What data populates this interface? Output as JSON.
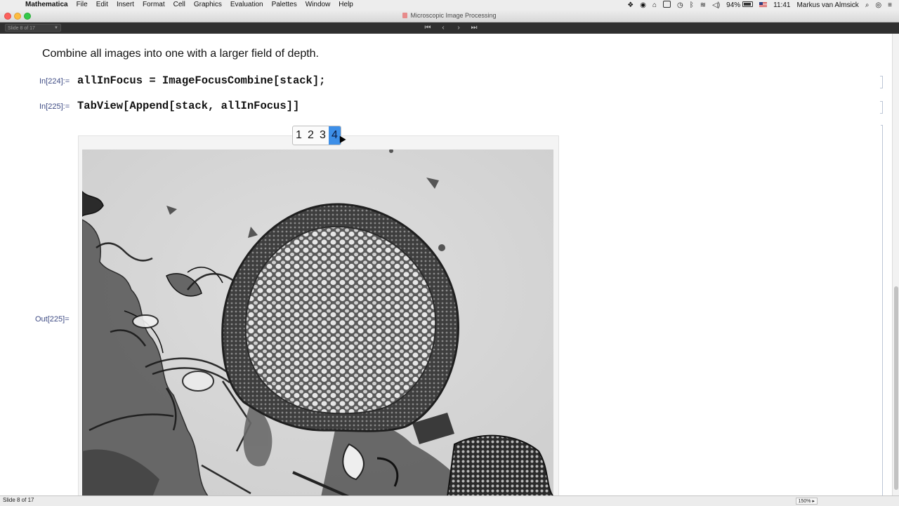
{
  "menubar": {
    "app": "Mathematica",
    "menus": [
      "File",
      "Edit",
      "Insert",
      "Format",
      "Cell",
      "Graphics",
      "Evaluation",
      "Palettes",
      "Window",
      "Help"
    ],
    "battery": "94%",
    "time": "11:41",
    "user": "Markus van Almsick"
  },
  "window": {
    "title": "Microscopic Image Processing"
  },
  "slidebar": {
    "selector_text": "Slide 8 of 17"
  },
  "notebook": {
    "text_cell": "Combine all images into one with a larger field of depth.",
    "cells": [
      {
        "label": "In[224]:=",
        "code": "allInFocus = ImageFocusCombine[stack];"
      },
      {
        "label": "In[225]:=",
        "code": "TabView[Append[stack, allInFocus]]"
      }
    ],
    "out_label": "Out[225]=",
    "tabs": [
      "1",
      "2",
      "3",
      "4"
    ],
    "selected_tab": "4"
  },
  "statusbar": {
    "slide": "Slide 8 of 17",
    "zoom": "150%"
  }
}
